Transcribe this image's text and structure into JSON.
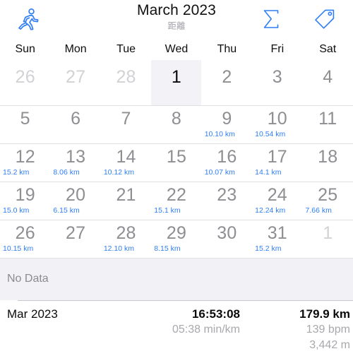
{
  "header": {
    "title": "March 2023",
    "subtitle": "距離",
    "icons": {
      "left": "running-icon",
      "right1": "sigma-icon",
      "right2": "tag-icon"
    },
    "accent_color": "#2f7ef4"
  },
  "weekdays": [
    "Sun",
    "Mon",
    "Tue",
    "Wed",
    "Thu",
    "Fri",
    "Sat"
  ],
  "calendar": {
    "highlight_column_index": 3,
    "weeks": [
      [
        {
          "day": "26",
          "km": "",
          "muted": true
        },
        {
          "day": "27",
          "km": "",
          "muted": true
        },
        {
          "day": "28",
          "km": "",
          "muted": true
        },
        {
          "day": "1",
          "km": "",
          "today": true
        },
        {
          "day": "2",
          "km": ""
        },
        {
          "day": "3",
          "km": ""
        },
        {
          "day": "4",
          "km": ""
        }
      ],
      [
        {
          "day": "5",
          "km": ""
        },
        {
          "day": "6",
          "km": ""
        },
        {
          "day": "7",
          "km": ""
        },
        {
          "day": "8",
          "km": ""
        },
        {
          "day": "9",
          "km": "10.10 km"
        },
        {
          "day": "10",
          "km": "10.54 km"
        },
        {
          "day": "11",
          "km": ""
        }
      ],
      [
        {
          "day": "12",
          "km": "15.2 km"
        },
        {
          "day": "13",
          "km": "8.06 km"
        },
        {
          "day": "14",
          "km": "10.12 km"
        },
        {
          "day": "15",
          "km": ""
        },
        {
          "day": "16",
          "km": "10.07 km"
        },
        {
          "day": "17",
          "km": "14.1 km"
        },
        {
          "day": "18",
          "km": ""
        }
      ],
      [
        {
          "day": "19",
          "km": "15.0 km"
        },
        {
          "day": "20",
          "km": "6.15 km"
        },
        {
          "day": "21",
          "km": ""
        },
        {
          "day": "22",
          "km": "15.1 km"
        },
        {
          "day": "23",
          "km": ""
        },
        {
          "day": "24",
          "km": "12.24 km"
        },
        {
          "day": "25",
          "km": "7.66 km"
        }
      ],
      [
        {
          "day": "26",
          "km": "10.15 km"
        },
        {
          "day": "27",
          "km": ""
        },
        {
          "day": "28",
          "km": "12.10 km"
        },
        {
          "day": "29",
          "km": "8.15 km"
        },
        {
          "day": "30",
          "km": ""
        },
        {
          "day": "31",
          "km": "15.2 km"
        },
        {
          "day": "1",
          "km": "",
          "muted": true
        }
      ]
    ]
  },
  "detail_panel": {
    "empty_label": "No Data"
  },
  "summary": {
    "period": "Mar 2023",
    "duration": "16:53:08",
    "pace": "05:38 min/km",
    "distance": "179.9 km",
    "heart_rate": "139 bpm",
    "elevation": "3,442 m"
  }
}
